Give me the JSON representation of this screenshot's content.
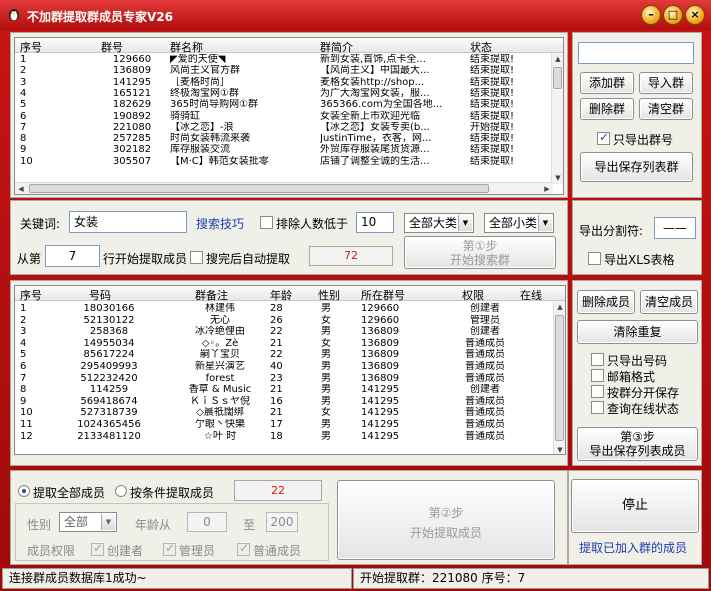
{
  "app": {
    "title": "不加群提取群成员专家V26",
    "minimize": "–",
    "maximize": "□",
    "close": "×"
  },
  "groups": {
    "headers": [
      "序号",
      "群号",
      "群名称",
      "群简介",
      "状态"
    ],
    "rows": [
      [
        "1",
        "129660",
        "◤爱的天使◥",
        "新到女装,首饰,点卡全...",
        "结束提取!"
      ],
      [
        "2",
        "136809",
        "风尚主义官方群",
        "【风尚主义】中国最大...",
        "结束提取!"
      ],
      [
        "3",
        "141295",
        "［麦格时尚］",
        "麦格女装http://shop...",
        "结束提取!"
      ],
      [
        "4",
        "165121",
        "终极淘宝网①群",
        "为广大淘宝网女装，服...",
        "结束提取!"
      ],
      [
        "5",
        "182629",
        "365时尚导购网①群",
        "365366.com为全国各地...",
        "结束提取!"
      ],
      [
        "6",
        "190892",
        "骑骑缸",
        "女装全新上市欢迎光临",
        "结束提取!"
      ],
      [
        "7",
        "221080",
        "【冰之恋】-浪",
        "【冰之恋】女装专卖(b...",
        "开始提取!"
      ],
      [
        "8",
        "257285",
        "时尚女装韩流来袭",
        "JustinTime，衣客，网...",
        "结束提取!"
      ],
      [
        "9",
        "302182",
        "库存服装交流",
        "外贸库存服装尾货货源...",
        "结束提取!"
      ],
      [
        "10",
        "305507",
        "【M·C】韩范女装批零",
        "店铺了调整全诚的生活...",
        "结束提取!"
      ]
    ]
  },
  "right_top": {
    "input_value": "",
    "add_group": "添加群",
    "import_group": "导入群",
    "delete_group": "删除群",
    "clear_group": "清空群",
    "only_export_number": "只导出群号",
    "export_save_groups": "导出保存列表群"
  },
  "search": {
    "keyword_label": "关键词:",
    "keyword_value": "女装",
    "tips_link": "搜索技巧",
    "exclude_label": "排除人数低于",
    "exclude_value": "10",
    "category_all": "全部大类",
    "subcategory_all": "全部小类",
    "from_label": "从第",
    "from_value": "7",
    "from_suffix": "行开始提取成员",
    "auto_extract_label": "搜完后自动提取",
    "count": "72",
    "step1_line1": "第①步",
    "step1_line2": "开始搜索群"
  },
  "export_opts": {
    "separator_label": "导出分割符:",
    "separator_value": "——",
    "xls_label": "导出XLS表格"
  },
  "members": {
    "headers": [
      "序号",
      "号码",
      "群备注",
      "年龄",
      "性别",
      "所在群号",
      "权限",
      "在线"
    ],
    "rows": [
      [
        "1",
        "18030166",
        "林建伟",
        "28",
        "男",
        "129660",
        "创建者"
      ],
      [
        "2",
        "52130122",
        "无心",
        "26",
        "女",
        "129660",
        "管理员"
      ],
      [
        "3",
        "258368",
        "冰冷绝俚由",
        "22",
        "男",
        "136809",
        "创建者"
      ],
      [
        "4",
        "14955034",
        "◇◦。Zè",
        "21",
        "女",
        "136809",
        "普通成员"
      ],
      [
        "5",
        "85617224",
        "嗣丫宝贝",
        "22",
        "男",
        "136809",
        "普通成员"
      ],
      [
        "6",
        "295409993",
        "新星兴演艺",
        "40",
        "男",
        "136809",
        "普通成员"
      ],
      [
        "7",
        "512232420",
        "forest",
        "23",
        "男",
        "136809",
        "普通成员"
      ],
      [
        "8",
        "114259",
        "香草 & Music",
        "21",
        "男",
        "141295",
        "创建者"
      ],
      [
        "9",
        "569418674",
        "ＫｉＳｓヤ倪",
        "16",
        "男",
        "141295",
        "普通成员"
      ],
      [
        "10",
        "527318739",
        "◇晨祇闊绑",
        "21",
        "女",
        "141295",
        "普通成员"
      ],
      [
        "11",
        "1024365456",
        "亇眼丶快樂",
        "17",
        "男",
        "141295",
        "普通成员"
      ],
      [
        "12",
        "2133481120",
        "☆叶 时",
        "18",
        "男",
        "141295",
        "普通成员"
      ]
    ]
  },
  "right_mid": {
    "delete_member": "删除成员",
    "clear_member": "清空成员",
    "dedup": "清除重复",
    "only_numbers": "只导出号码",
    "email_format": "邮箱格式",
    "by_group": "按群分开保存",
    "query_online": "查询在线状态",
    "step3_line1": "第③步",
    "step3_line2": "导出保存列表成员"
  },
  "extract": {
    "all_label": "提取全部成员",
    "cond_label": "按条件提取成员",
    "count": "22",
    "gender_label": "性别",
    "gender_value": "全部",
    "age_label": "年龄从",
    "age_from": "0",
    "age_to_label": "至",
    "age_to": "200",
    "perm_label": "成员权限",
    "creator": "创建者",
    "admin": "管理员",
    "normal": "普通成员",
    "step2_line1": "第②步",
    "step2_line2": "开始提取成员"
  },
  "stop": {
    "label": "停止",
    "link": "提取已加入群的成员"
  },
  "statusbar": {
    "left": "连接群成员数据库1成功~",
    "right": "开始提取群：221080 序号：7"
  }
}
